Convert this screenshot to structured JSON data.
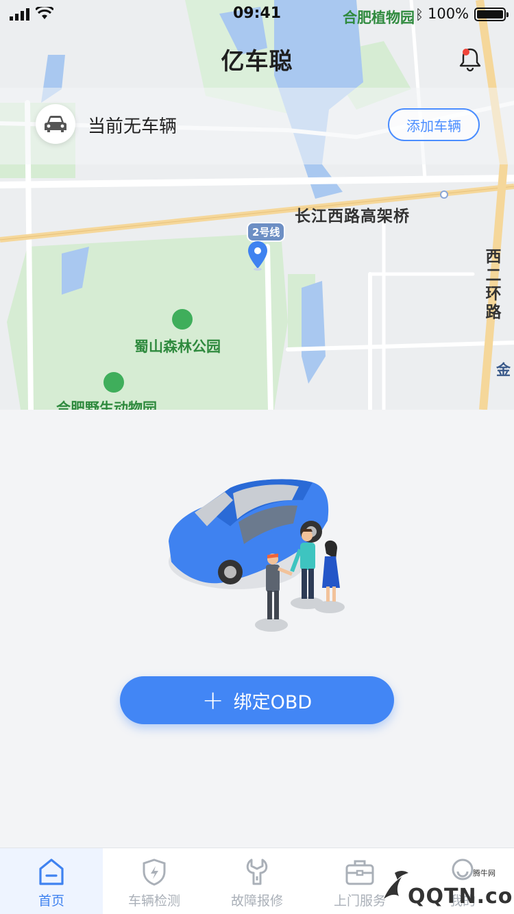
{
  "status_bar": {
    "time": "09:41",
    "battery": "100%"
  },
  "header": {
    "title": "亿车聪"
  },
  "vehicle": {
    "status_text": "当前无车辆",
    "add_button": "添加车辆"
  },
  "map": {
    "labels": {
      "road": "长江西路高架桥",
      "ring_road": "西二环路",
      "park": "蜀山森林公园",
      "zoo": "合肥野生动物园",
      "garden": "合肥植物园",
      "metro_line": "2号线",
      "edge": "金"
    },
    "colors": {
      "water": "#a9c8f0",
      "green": "#d6ecd3",
      "highway": "#f5d79a",
      "pin": "#3f82f0"
    }
  },
  "main": {
    "bind_button": "绑定OBD"
  },
  "tabbar": {
    "items": [
      {
        "label": "首页",
        "icon": "home-icon",
        "active": true
      },
      {
        "label": "车辆检测",
        "icon": "shield-bolt-icon",
        "active": false
      },
      {
        "label": "故障报修",
        "icon": "wrench-icon",
        "active": false
      },
      {
        "label": "上门服务",
        "icon": "briefcase-icon",
        "active": false
      },
      {
        "label": "我的",
        "icon": "user-icon",
        "active": false
      }
    ]
  },
  "watermark": {
    "text": "QQTN.com",
    "small": "腾牛网"
  }
}
